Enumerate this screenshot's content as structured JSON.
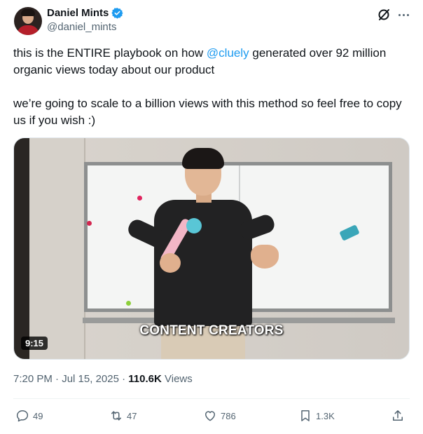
{
  "author": {
    "display_name": "Daniel Mints",
    "handle": "@daniel_mints",
    "verified": true
  },
  "tweet": {
    "line1_before": "this is the ENTIRE playbook on how ",
    "mention": "@cluely",
    "line1_after": " generated over 92 million organic views today about our product",
    "paragraph2": "we’re going to scale to a billion views with this method so feel free to copy us if you wish :)"
  },
  "media": {
    "type": "video",
    "caption_overlay": "CONTENT CREATORS",
    "duration": "9:15"
  },
  "meta": {
    "time": "7:20 PM",
    "date": "Jul 15, 2025",
    "views_count": "110.6K",
    "views_label": "Views"
  },
  "actions": {
    "replies": "49",
    "reposts": "47",
    "likes": "786",
    "bookmarks": "1.3K"
  },
  "icons": {
    "reply": "reply-icon",
    "repost": "repost-icon",
    "like": "heart-icon",
    "bookmark": "bookmark-icon",
    "share": "share-icon",
    "more": "more-icon",
    "grok": "grok-icon",
    "verified": "verified-badge-icon"
  },
  "colors": {
    "accent": "#1d9bf0",
    "text": "#0f1419",
    "muted": "#536471"
  }
}
